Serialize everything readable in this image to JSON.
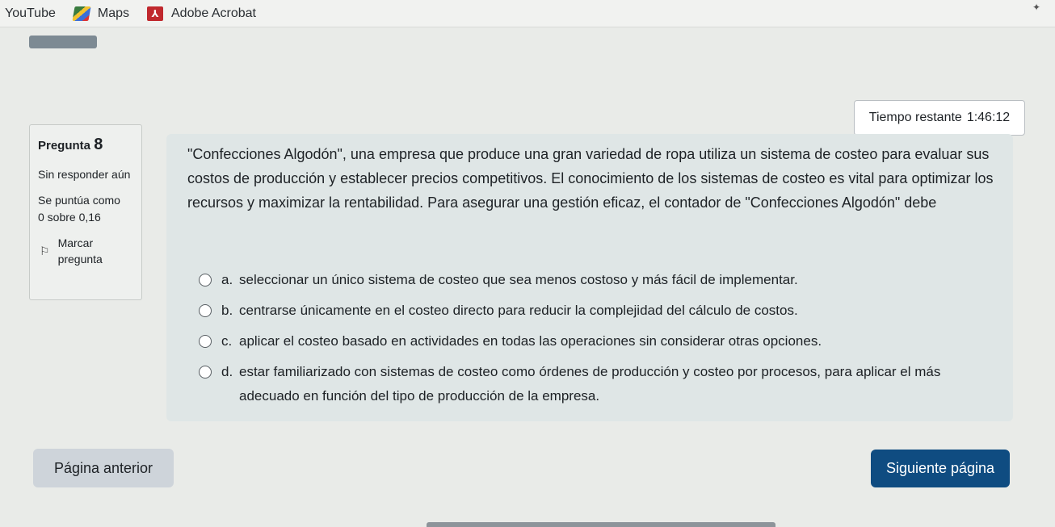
{
  "bookmarks": [
    {
      "label": "YouTube",
      "icon": "youtube-icon"
    },
    {
      "label": "Maps",
      "icon": "maps-icon"
    },
    {
      "label": "Adobe Acrobat",
      "icon": "acrobat-icon"
    }
  ],
  "timer": {
    "label": "Tiempo restante",
    "value": "1:46:12"
  },
  "info": {
    "question_label": "Pregunta",
    "question_number": "8",
    "status": "Sin responder aún",
    "score_label": "Se puntúa como",
    "score_value": "0 sobre 0,16",
    "flag_label": "Marcar pregunta"
  },
  "question": {
    "text": "\"Confecciones Algodón\", una empresa que produce una gran variedad de ropa utiliza un sistema de costeo para evaluar sus costos de producción y establecer precios competitivos. El conocimiento de los sistemas de costeo es vital para optimizar los recursos y maximizar la rentabilidad. Para asegurar una gestión eficaz, el contador de \"Confecciones Algodón\" debe",
    "answers": [
      {
        "letter": "a.",
        "text": "seleccionar un único sistema de costeo que sea menos costoso y más fácil de implementar."
      },
      {
        "letter": "b.",
        "text": "centrarse únicamente en el costeo directo para reducir la complejidad del cálculo de costos."
      },
      {
        "letter": "c.",
        "text": "aplicar el costeo basado en actividades en todas las operaciones sin considerar otras opciones."
      },
      {
        "letter": "d.",
        "text": "estar familiarizado con sistemas de costeo como órdenes de producción y costeo por procesos, para aplicar el más adecuado en función del tipo de producción de la empresa."
      }
    ]
  },
  "nav": {
    "prev_label": "Página anterior",
    "next_label": "Siguiente página"
  },
  "colors": {
    "primary": "#0f4c81",
    "secondary": "#ced4da",
    "question_bg": "#dfe6e6"
  }
}
